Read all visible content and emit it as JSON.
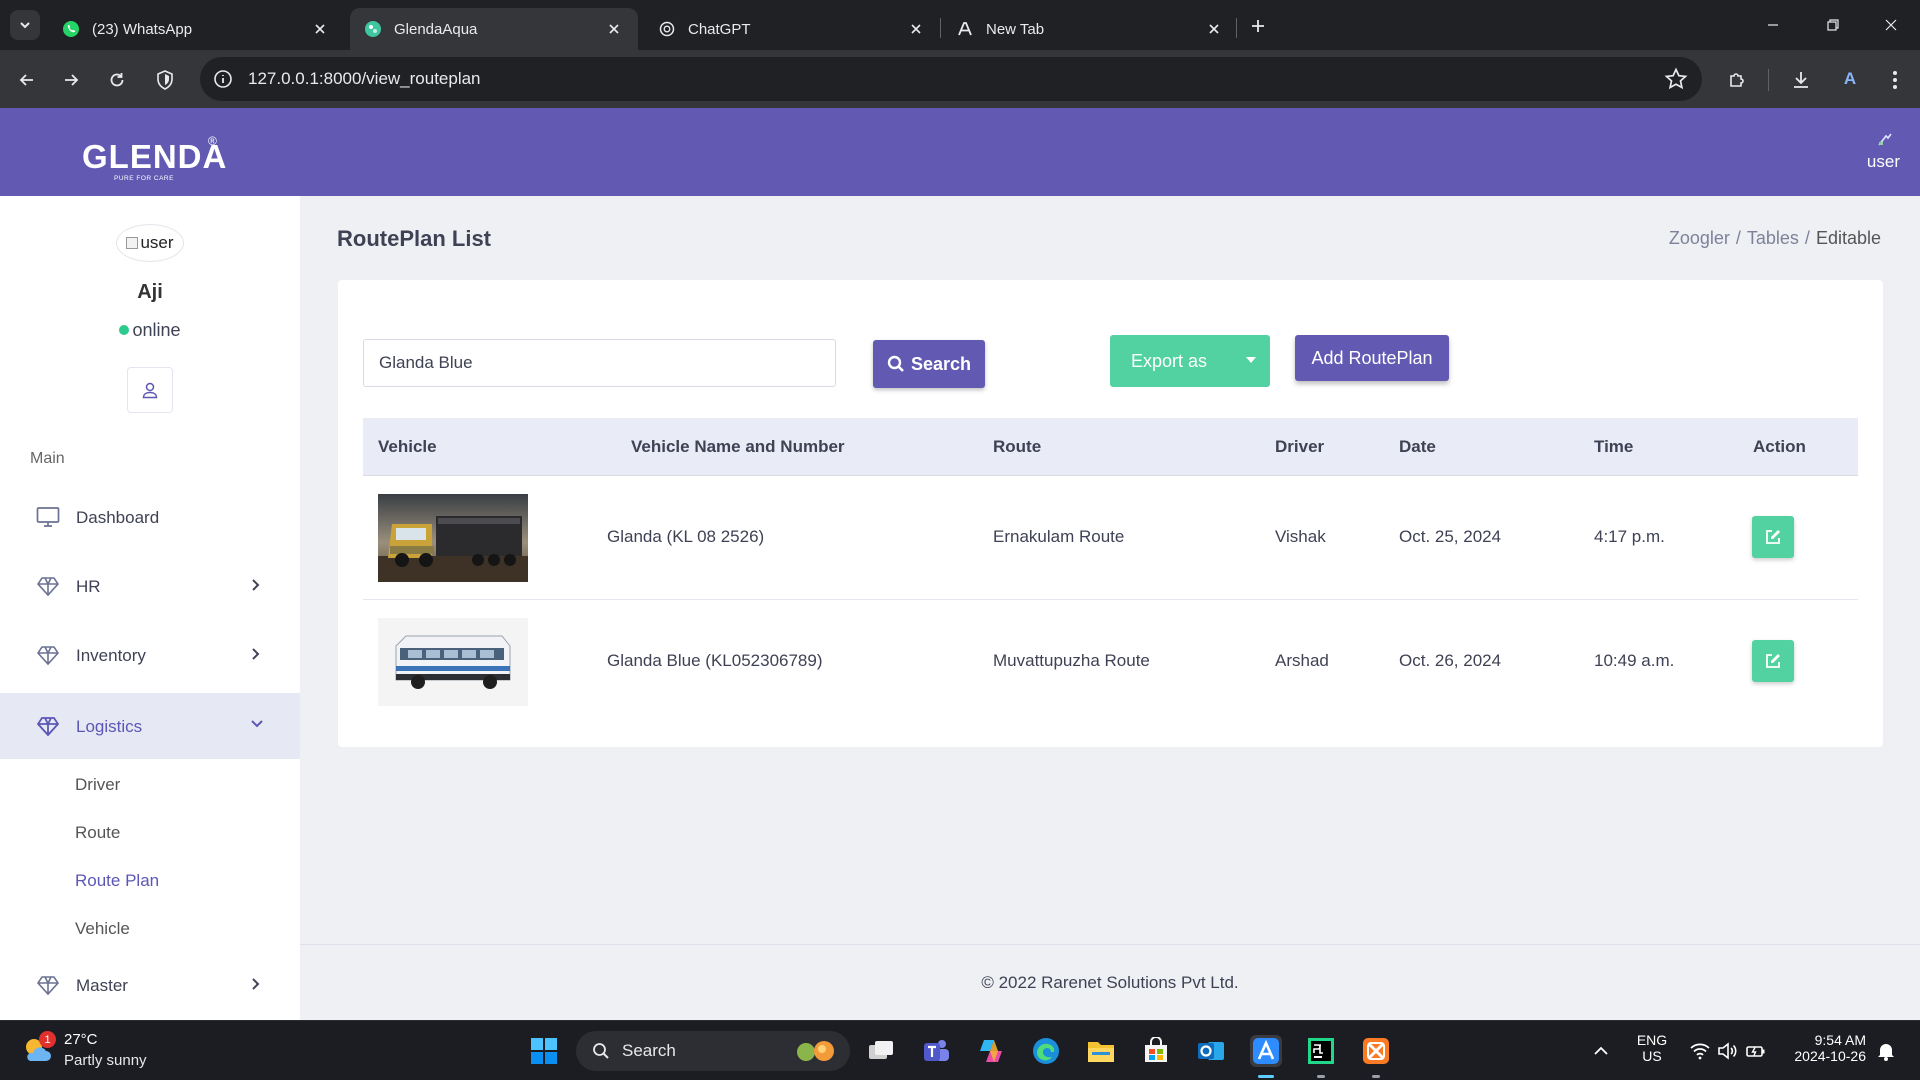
{
  "browser": {
    "tabs": [
      {
        "title": "(23) WhatsApp",
        "icon": "whatsapp-icon",
        "active": false
      },
      {
        "title": "GlendaAqua",
        "icon": "site-icon",
        "active": true
      },
      {
        "title": "ChatGPT",
        "icon": "chatgpt-icon",
        "active": false
      },
      {
        "title": "New Tab",
        "icon": "newtab-icon",
        "active": false
      }
    ],
    "url": "127.0.0.1:8000/view_routeplan",
    "profile_initial": "A"
  },
  "header": {
    "logo_text": "GLENDA",
    "logo_reg": "®",
    "logo_tagline": "PURE FOR CARE",
    "user_label": "user"
  },
  "sidebar": {
    "avatar_alt": "user",
    "user_name": "Aji",
    "status": "online",
    "section_label": "Main",
    "nav": [
      {
        "label": "Dashboard",
        "icon": "monitor-icon",
        "has_children": false
      },
      {
        "label": "HR",
        "icon": "diamond-icon",
        "has_children": true
      },
      {
        "label": "Inventory",
        "icon": "diamond-icon",
        "has_children": true
      },
      {
        "label": "Logistics",
        "icon": "diamond-icon",
        "has_children": true,
        "expanded": true
      },
      {
        "label": "Master",
        "icon": "diamond-icon",
        "has_children": true
      }
    ],
    "logistics_sub": [
      {
        "label": "Driver",
        "active": false
      },
      {
        "label": "Route",
        "active": false
      },
      {
        "label": "Route Plan",
        "active": true
      },
      {
        "label": "Vehicle",
        "active": false
      }
    ]
  },
  "page": {
    "title": "RoutePlan List",
    "breadcrumb": [
      "Zoogler",
      "Tables",
      "Editable"
    ],
    "breadcrumb_sep": "/"
  },
  "toolbar": {
    "search_value": "Glanda Blue",
    "search_label": "Search",
    "export_label": "Export as",
    "add_label": "Add RoutePlan"
  },
  "table": {
    "columns": [
      "Vehicle",
      "Vehicle Name and Number",
      "Route",
      "Driver",
      "Date",
      "Time",
      "Action"
    ],
    "rows": [
      {
        "vehicle_image": "truck-photo",
        "vehicle_name": "Glanda (KL 08 2526)",
        "route": "Ernakulam Route",
        "driver": "Vishak",
        "date": "Oct. 25, 2024",
        "time": "4:17 p.m."
      },
      {
        "vehicle_image": "bus-photo",
        "vehicle_name": "Glanda Blue (KL052306789)",
        "route": "Muvattupuzha Route",
        "driver": "Arshad",
        "date": "Oct. 26, 2024",
        "time": "10:49 a.m."
      }
    ]
  },
  "footer": {
    "copyright": "© 2022 Rarenet Solutions Pvt Ltd."
  },
  "taskbar": {
    "weather_temp": "27°C",
    "weather_cond": "Partly sunny",
    "weather_badge": "1",
    "search_label": "Search",
    "lang": "ENG",
    "region": "US",
    "time": "9:54 AM",
    "date": "2024-10-26"
  },
  "colors": {
    "header": "#6259b3",
    "accent_green": "#52d2a0",
    "sidebar_active": "#5c57b5",
    "online": "#2dc98d"
  }
}
